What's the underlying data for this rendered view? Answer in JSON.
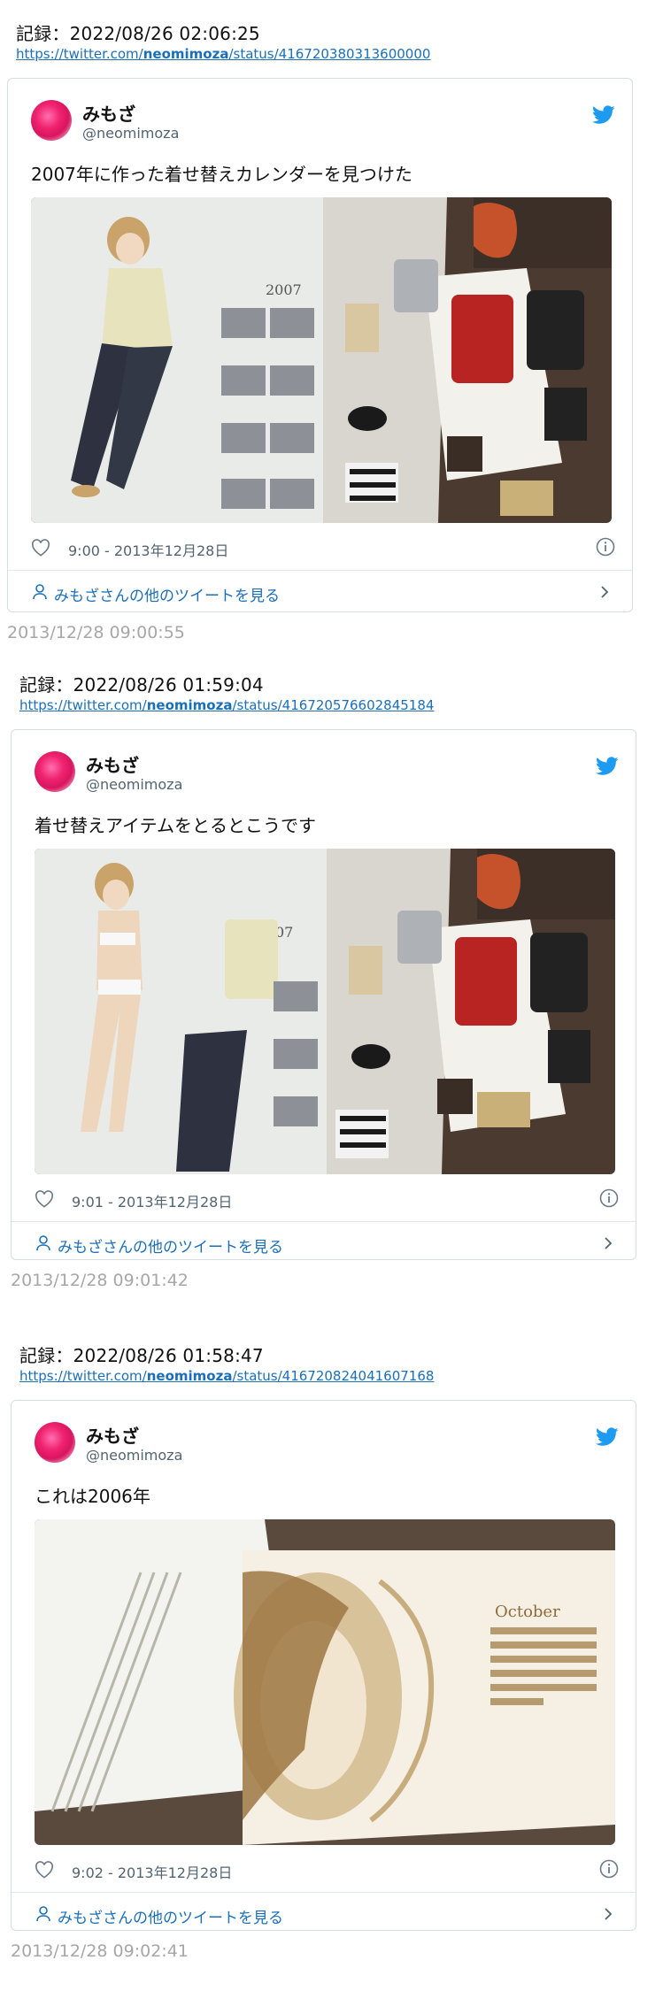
{
  "tweets": [
    {
      "record": "記録：2022/08/26 02:06:25",
      "url_prefix": "https://twitter.com/",
      "url_user": "neomimoza",
      "url_suffix": "/status/416720380313600000",
      "name": "みもざ",
      "handle": "@neomimoza",
      "text": "2007年に作った着せ替えカレンダーを見つけた",
      "time": "9:00 - 2013年12月28日",
      "more": "みもざさんの他のツイートを見る",
      "archived": "2013/12/28 09:00:55",
      "photo_year": "2007"
    },
    {
      "record": "記録：2022/08/26 01:59:04",
      "url_prefix": "https://twitter.com/",
      "url_user": "neomimoza",
      "url_suffix": "/status/416720576602845184",
      "name": "みもざ",
      "handle": "@neomimoza",
      "text": "着せ替えアイテムをとるとこうです",
      "time": "9:01 - 2013年12月28日",
      "more": "みもざさんの他のツイートを見る",
      "archived": "2013/12/28 09:01:42",
      "photo_year": "07"
    },
    {
      "record": "記録：2022/08/26 01:58:47",
      "url_prefix": "https://twitter.com/",
      "url_user": "neomimoza",
      "url_suffix": "/status/416720824041607168",
      "name": "みもざ",
      "handle": "@neomimoza",
      "text": "これは2006年",
      "time": "9:02 - 2013年12月28日",
      "more": "みもざさんの他のツイートを見る",
      "archived": "2013/12/28 09:02:41",
      "photo_month": "October"
    }
  ],
  "colors": {
    "link": "#1b6fb8",
    "twitter_blue": "#1d9bf0",
    "muted": "#536471",
    "archive_gray": "#a7a7a7"
  },
  "icons": [
    "twitter-bird-icon",
    "heart-icon",
    "info-icon",
    "person-icon",
    "chevron-right-icon"
  ]
}
